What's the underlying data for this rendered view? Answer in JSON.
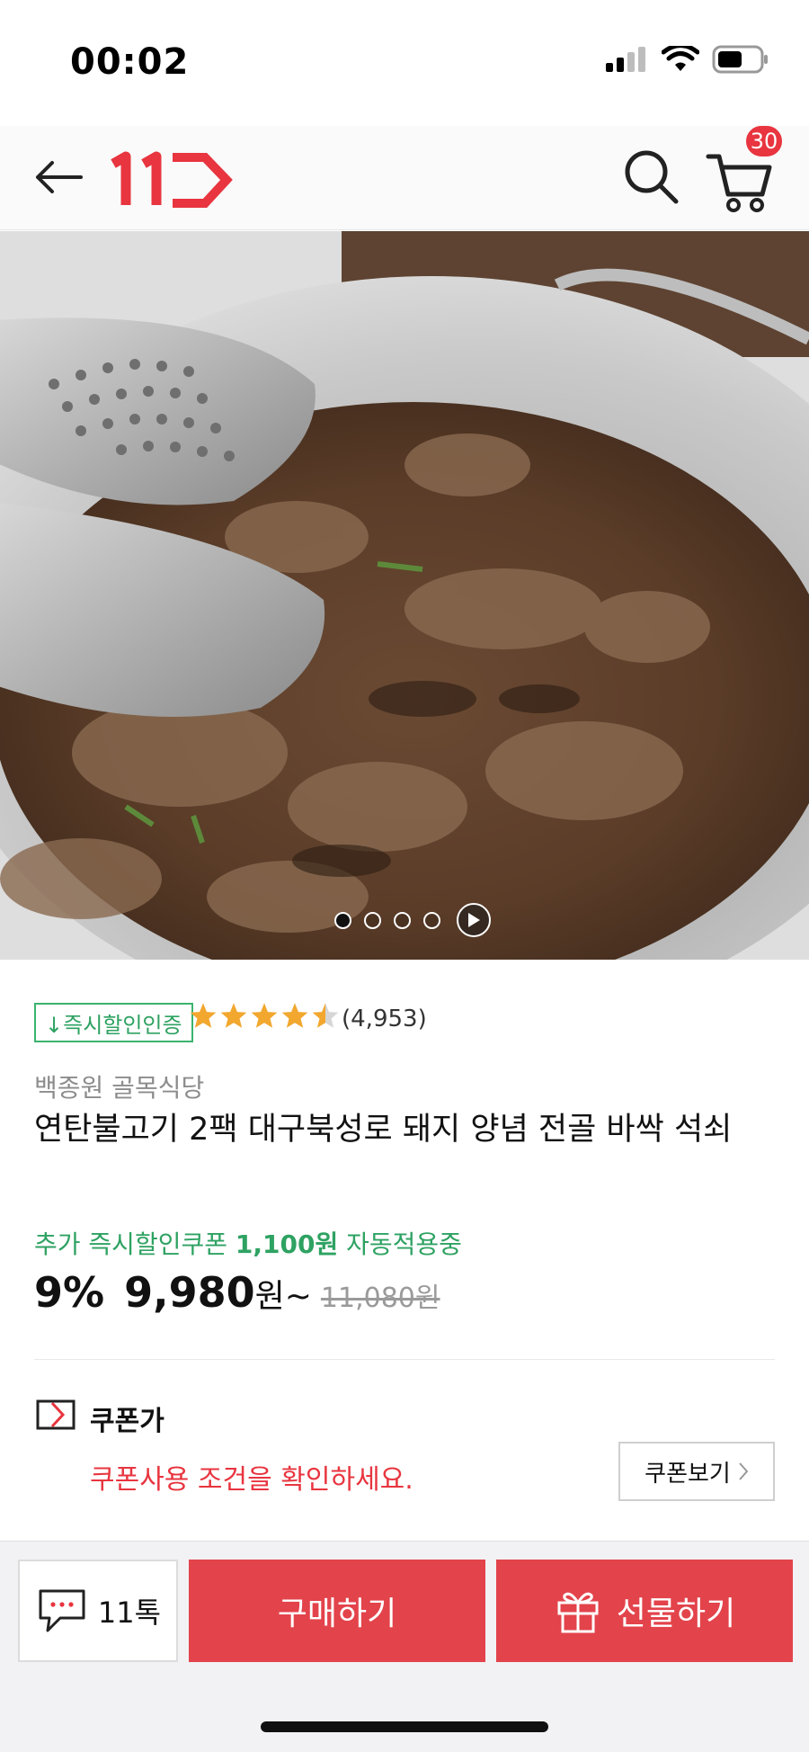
{
  "status_bar": {
    "time": "00:02",
    "icons": [
      "signal-icon",
      "wifi-icon",
      "battery-icon"
    ]
  },
  "header": {
    "logo": "11번가",
    "cart_count": "30",
    "icons": [
      "back-arrow-icon",
      "search-icon",
      "cart-icon"
    ]
  },
  "gallery": {
    "image_count": 4,
    "active_index": 0,
    "has_video": true
  },
  "product": {
    "cert_badge": "↓즉시할인인증",
    "rating": 4.5,
    "rating_count": "(4,953)",
    "seller": "백종원 골목식당",
    "title": "연탄불고기 2팩 대구북성로 돼지 양념 전골 바싹 석쇠",
    "coupon_note_prefix": "추가 즉시할인쿠폰 ",
    "coupon_note_amount": "1,100원",
    "coupon_note_suffix": " 자동적용중",
    "discount": "9%",
    "price": "9,980",
    "price_unit": "원~",
    "original_price": "11,080원"
  },
  "coupon": {
    "label": "쿠폰가",
    "warning": "쿠폰사용 조건을 확인하세요.",
    "view_button": "쿠폰보기"
  },
  "bottom_bar": {
    "talk_label": "11톡",
    "buy_label": "구매하기",
    "gift_label": "선물하기"
  },
  "colors": {
    "brand_red": "#e3434b",
    "green": "#2ea262",
    "star": "#f2a72e"
  }
}
